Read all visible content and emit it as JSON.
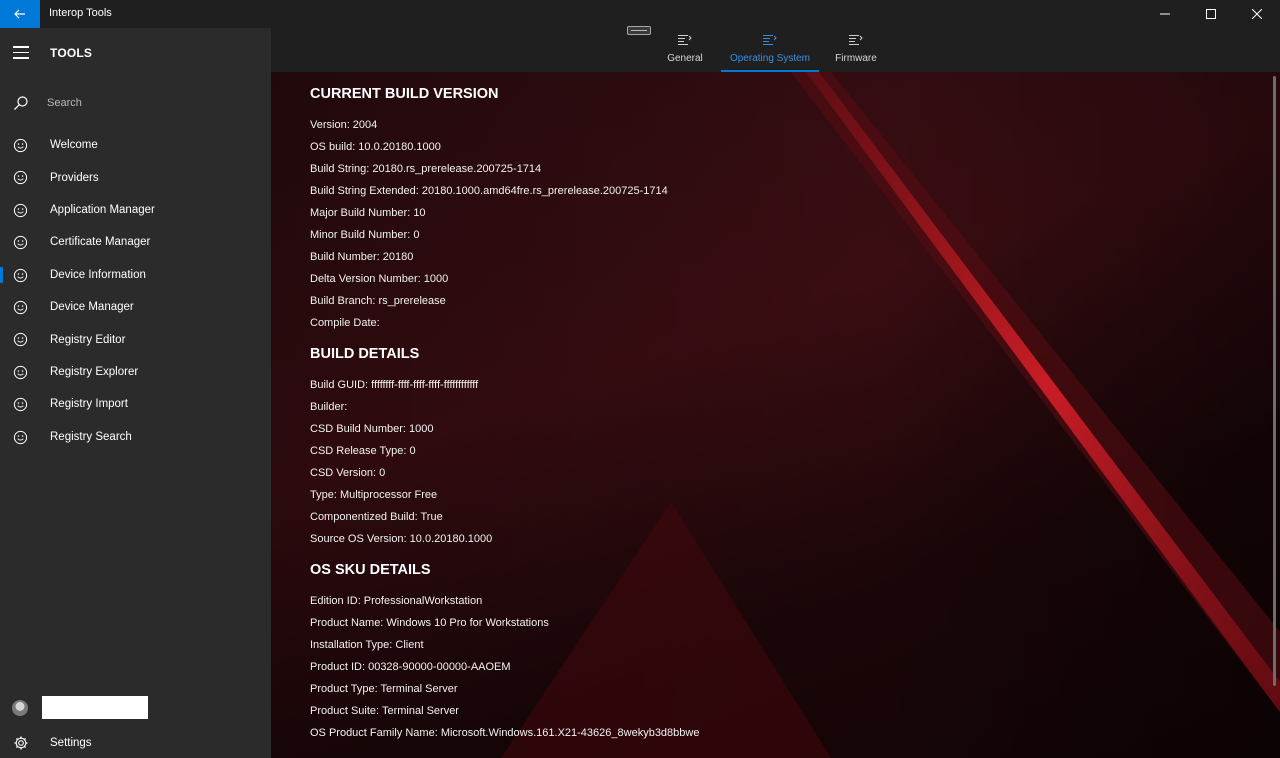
{
  "window": {
    "title": "Interop Tools",
    "icons": {
      "back": "arrow-left-icon",
      "minimize": "minimize-icon",
      "maximize": "maximize-icon",
      "close": "close-icon"
    }
  },
  "sidebar": {
    "title": "TOOLS",
    "search_placeholder": "Search",
    "items": [
      {
        "label": "Welcome",
        "icon": "smiley-icon",
        "selected": false
      },
      {
        "label": "Providers",
        "icon": "smiley-icon",
        "selected": false
      },
      {
        "label": "Application Manager",
        "icon": "smiley-icon",
        "selected": false
      },
      {
        "label": "Certificate Manager",
        "icon": "smiley-icon",
        "selected": false
      },
      {
        "label": "Device Information",
        "icon": "smiley-icon",
        "selected": true
      },
      {
        "label": "Device Manager",
        "icon": "smiley-icon",
        "selected": false
      },
      {
        "label": "Registry Editor",
        "icon": "smiley-icon",
        "selected": false
      },
      {
        "label": "Registry Explorer",
        "icon": "smiley-icon",
        "selected": false
      },
      {
        "label": "Registry Import",
        "icon": "smiley-icon",
        "selected": false
      },
      {
        "label": "Registry Search",
        "icon": "smiley-icon",
        "selected": false
      }
    ],
    "settings_label": "Settings"
  },
  "tabs": [
    {
      "label": "General",
      "active": false
    },
    {
      "label": "Operating System",
      "active": true
    },
    {
      "label": "Firmware",
      "active": false
    }
  ],
  "colors": {
    "accent": "#0078d7",
    "sidebar_bg": "#2b2b2b",
    "titlebar_bg": "#1f1f1f",
    "content_bg": "#2b0c10"
  },
  "sections": {
    "current_build": {
      "title": "CURRENT BUILD VERSION",
      "rows": [
        "Version: 2004",
        "OS build: 10.0.20180.1000",
        "Build String: 20180.rs_prerelease.200725-1714",
        "Build String Extended: 20180.1000.amd64fre.rs_prerelease.200725-1714",
        "Major Build Number: 10",
        "Minor Build Number: 0",
        "Build Number: 20180",
        "Delta Version Number: 1000",
        "Build Branch: rs_prerelease",
        "Compile Date:"
      ]
    },
    "build_details": {
      "title": "BUILD DETAILS",
      "rows": [
        "Build GUID: ffffffff-ffff-ffff-ffff-ffffffffffff",
        "Builder:",
        "CSD Build Number: 1000",
        "CSD Release Type: 0",
        "CSD Version: 0",
        "Type: Multiprocessor Free",
        "Componentized Build: True",
        "Source OS Version: 10.0.20180.1000"
      ]
    },
    "os_sku": {
      "title": "OS SKU DETAILS",
      "rows": [
        "Edition ID: ProfessionalWorkstation",
        "Product Name: Windows 10 Pro for Workstations",
        "Installation Type: Client",
        "Product ID: 00328-90000-00000-AAOEM",
        "Product Type: Terminal Server",
        "Product Suite: Terminal Server",
        "OS Product Family Name: Microsoft.Windows.161.X21-43626_8wekyb3d8bbwe"
      ]
    }
  }
}
